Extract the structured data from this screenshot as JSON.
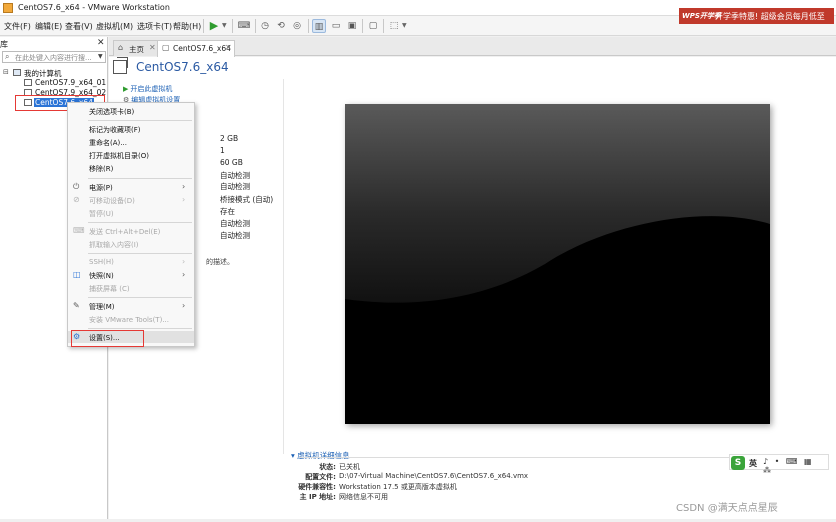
{
  "window": {
    "title": "CentOS7.6_x64 - VMware Workstation"
  },
  "ad": {
    "logo": "WPS开学季",
    "text": "开学季特惠! 超级会员每月低至"
  },
  "menu": {
    "file": "文件(F)",
    "edit": "编辑(E)",
    "view": "查看(V)",
    "vm": "虚拟机(M)",
    "tabs": "选项卡(T)",
    "help": "帮助(H)"
  },
  "library": {
    "title": "库",
    "search_placeholder": "在此处键入内容进行搜...",
    "root": "我的计算机",
    "items": [
      "CentOS7.9_x64_01",
      "CentOS7.9_x64_02",
      "CentOS7.6_x64"
    ]
  },
  "tabs": {
    "home": "主页",
    "active": "CentOS7.6_x64"
  },
  "vm": {
    "title": "CentOS7.6_x64",
    "actions": {
      "power_on": "开启此虚拟机",
      "edit_settings": "编辑虚拟机设置"
    },
    "hardware_values": [
      "2 GB",
      "1",
      "60 GB",
      "自动检测",
      "自动检测",
      "桥接模式 (自动)",
      "存在",
      "自动检测",
      "自动检测"
    ],
    "description_fragment": "的描述。"
  },
  "details": {
    "header": "虚拟机详细信息",
    "rows": [
      {
        "label": "状态:",
        "value": "已关机"
      },
      {
        "label": "配置文件:",
        "value": "D:\\07-Virtual Machine\\CentOS7.6\\CentOS7.6_x64.vmx"
      },
      {
        "label": "硬件兼容性:",
        "value": "Workstation 17.5 或更高版本虚拟机"
      },
      {
        "label": "主 IP 地址:",
        "value": "网络信息不可用"
      }
    ]
  },
  "context_menu": {
    "close_tab": "关闭选项卡(B)",
    "favorite": "标记为收藏项(F)",
    "rename": "重命名(A)...",
    "open_dir": "打开虚拟机目录(O)",
    "remove": "移除(R)",
    "power": "电源(P)",
    "removable": "可移动设备(D)",
    "pause": "暂停(U)",
    "send_cad": "发送 Ctrl+Alt+Del(E)",
    "grab_input": "抓取输入内容(I)",
    "ssh": "SSH(H)",
    "snapshot": "快照(N)",
    "capture": "捕获屏幕 (C)",
    "manage": "管理(M)",
    "install_tools": "安装 VMware Tools(T)...",
    "settings": "设置(S)..."
  },
  "ime": {
    "logo": "S",
    "lang": "英",
    "icons": "♪ • ⌨ ▦ ⁂"
  },
  "watermark": {
    "text": "CSDN @满天点点星辰"
  }
}
